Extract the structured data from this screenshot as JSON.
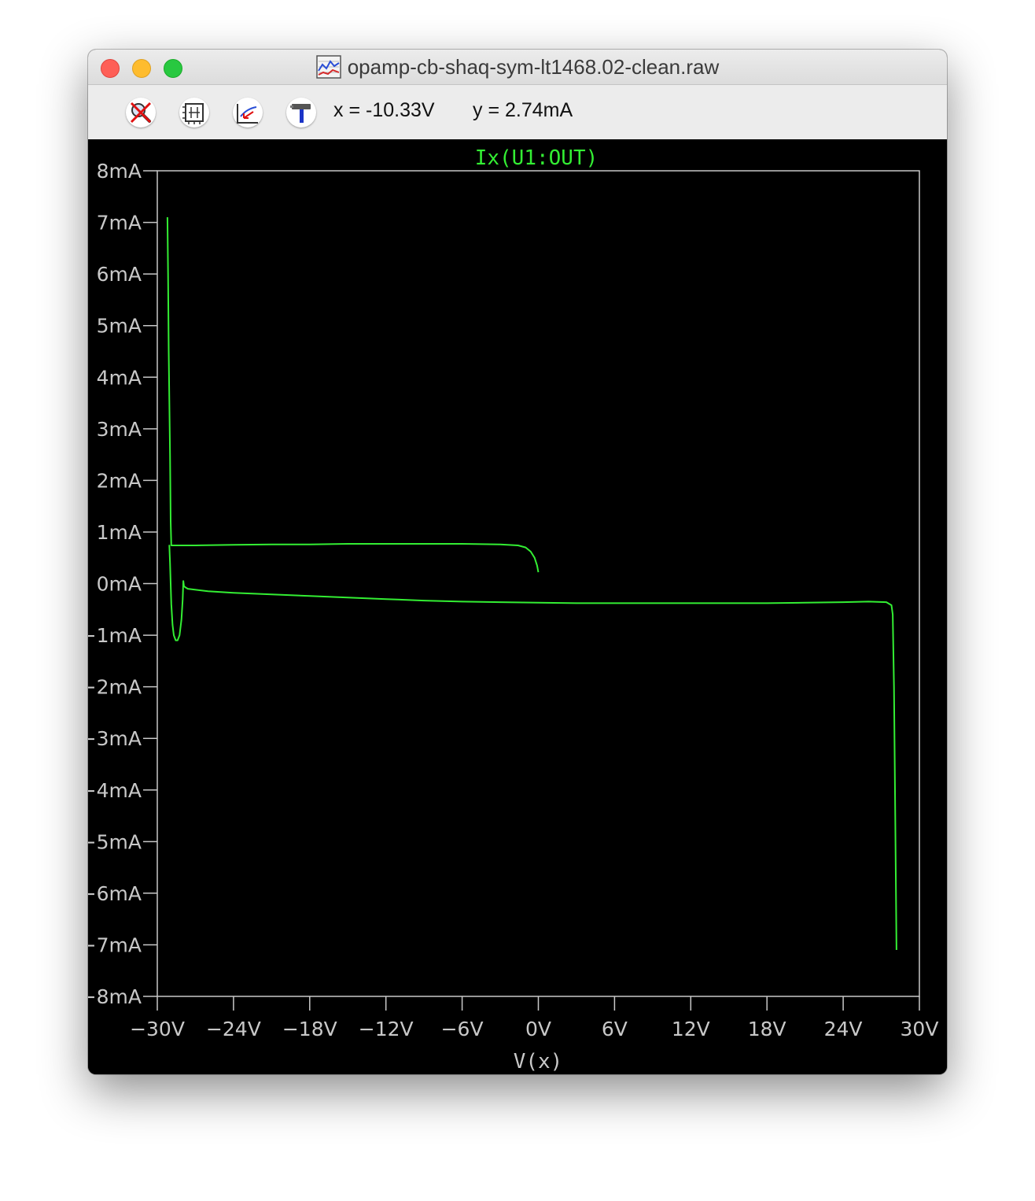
{
  "window": {
    "title": "opamp-cb-shaq-sym-lt1468.02-clean.raw"
  },
  "toolbar": {
    "buttons": [
      {
        "name": "zoom-cancel-button",
        "icon": "zoom-cancel-icon"
      },
      {
        "name": "autoscale-button",
        "icon": "autoscale-icon"
      },
      {
        "name": "zoom-back-button",
        "icon": "zoom-back-icon"
      },
      {
        "name": "tools-button",
        "icon": "hammer-icon"
      }
    ],
    "cursor_x": "x = -10.33V",
    "cursor_y": "y = 2.74mA"
  },
  "colors": {
    "trace": "#33ee33",
    "plot_bg": "#000000",
    "axis": "#c8c8c8"
  },
  "chart_data": {
    "type": "line",
    "title": "Ix(U1:OUT)",
    "xlabel": "V(x)",
    "ylabel": "",
    "xlim": [
      -30,
      30
    ],
    "ylim": [
      -8,
      8
    ],
    "x_ticks": [
      "−30V",
      "−24V",
      "−18V",
      "−12V",
      "−6V",
      "0V",
      "6V",
      "12V",
      "18V",
      "24V",
      "30V"
    ],
    "y_ticks": [
      "8mA",
      "7mA",
      "6mA",
      "5mA",
      "4mA",
      "3mA",
      "2mA",
      "1mA",
      "0mA",
      "−1mA",
      "−2mA",
      "−3mA",
      "−4mA",
      "−5mA",
      "−6mA",
      "−7mA",
      "−8mA"
    ],
    "grid": false,
    "series": [
      {
        "name": "Ix(U1:OUT)",
        "x": [
          -29.2,
          -29.1,
          -28.9,
          -28.8,
          -28.75,
          -28.7,
          -28.5,
          -28.2,
          -28.0,
          -27.9,
          -27.8,
          -27.7,
          -27.6,
          -27.5,
          -27.3,
          -26.5,
          -24,
          -21,
          -18,
          -15,
          -12,
          -9,
          -6,
          -3,
          -1.5,
          -1.0,
          -0.5,
          -0.2,
          0.0,
          0.0,
          -1,
          -3,
          -6,
          -9,
          -12,
          -15,
          -18,
          -21,
          -24,
          -26,
          -27.6,
          -27.8,
          -27.9,
          -28.0,
          -28.05
        ],
        "y": [
          -1.0,
          -0.95,
          -0.7,
          -0.3,
          0.0,
          0.75,
          0.74,
          0.73,
          0.73,
          0.73,
          0.73,
          0.73,
          0.73,
          0.73,
          0.74,
          0.74,
          0.75,
          0.76,
          0.76,
          0.77,
          0.77,
          0.77,
          0.77,
          0.77,
          0.76,
          0.74,
          0.7,
          0.55,
          0.22,
          0.22,
          0.22,
          0.22,
          0.22,
          0.22,
          0.22,
          0.22,
          0.22,
          0.22,
          0.22,
          0.22,
          0.22,
          0.22,
          0.22,
          0.22,
          0.22
        ]
      }
    ]
  }
}
